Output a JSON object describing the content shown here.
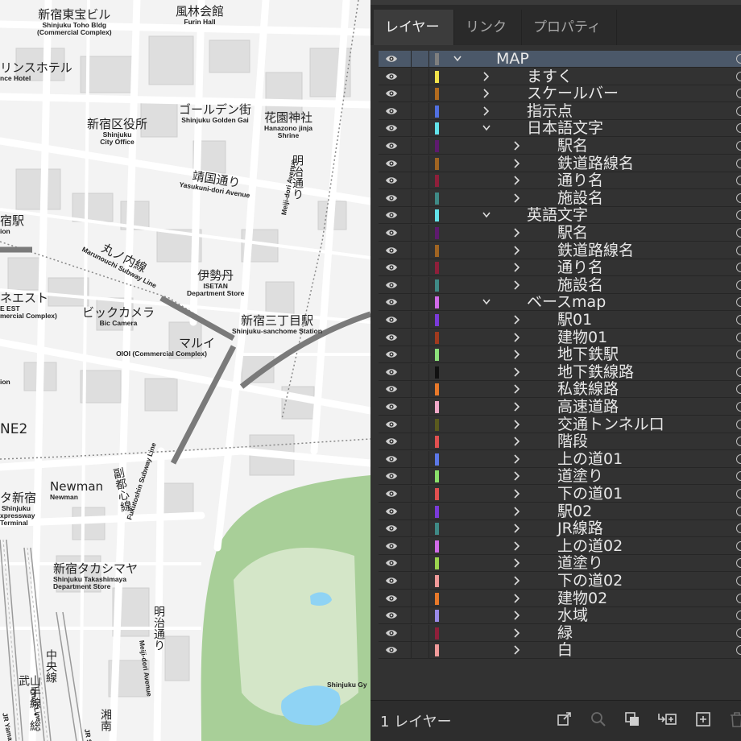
{
  "map": {
    "labels": {
      "toho_jp": "新宿東宝ビル",
      "toho_en1": "Shinjuku Toho Bldg",
      "toho_en2": "(Commercial Complex)",
      "furin_jp": "風林会館",
      "furin_en": "Furin Hall",
      "hotel_jp": "リンスホテル",
      "hotel_en": "nce Hotel",
      "golden_jp": "ゴールデン街",
      "golden_en": "Shinjuku Golden Gai",
      "hanazono_jp": "花園神社",
      "hanazono_en1": "Hanazono jinja",
      "hanazono_en2": "Shrine",
      "office_jp": "新宿区役所",
      "office_en1": "Shinjuku",
      "office_en2": "City Office",
      "yasukuni_jp": "靖国通り",
      "yasukuni_en": "Yasukuni-dori Avenue",
      "meiji1_jp": "明治通り",
      "meiji1_en": "Meiji-dori Avenue",
      "station_jp": "宿駅",
      "station_en": "ion",
      "marunouchi_jp": "丸ノ内線",
      "marunouchi_en": "Marunouchi Subway Line",
      "isetan_jp": "伊勢丹",
      "isetan_en1": "ISETAN",
      "isetan_en2": "Department Store",
      "lumine_jp": "ネエスト",
      "lumine_en1": "E EST",
      "lumine_en2": "mercial Complex)",
      "bic_jp": "ビックカメラ",
      "bic_en": "Bic Camera",
      "sanchome_jp": "新宿三丁目駅",
      "sanchome_en": "Shinjuku-sanchome Station",
      "marui_jp": "マルイ",
      "marui_en": "OIOI (Commercial Complex)",
      "ion2": "ion",
      "ne2": "NE2",
      "fukutoshin_jp": "副都心線",
      "fukutoshin_en": "Fukutoshin Subway Line",
      "newman_jp": "Newman",
      "newman_en": "Newman",
      "busta_jp": "タ新宿",
      "busta_en1": "Shinjuku",
      "busta_en2": "xpressway",
      "busta_en3": "Terminal",
      "takashimaya_jp": "新宿タカシマヤ",
      "takashimaya_en1": "Shinjuku Takashimaya",
      "takashimaya_en2": "Department Store",
      "meiji2_jp": "明治通り",
      "meiji2_en": "Meiji-dori Avenue",
      "chuo_jp": "中央線",
      "chuo_en": "Chuo Line",
      "yamanote_jp": "山手線・総武",
      "yamanote_en": "JR Yamanote Line",
      "shonan_jp": "湘南",
      "shonan_en": "JR Shon",
      "gyoen_en": "Shinjuku Gy"
    }
  },
  "panel": {
    "tabs": [
      {
        "label": "レイヤー",
        "active": true
      },
      {
        "label": "リンク",
        "active": false
      },
      {
        "label": "プロパティ",
        "active": false
      }
    ],
    "layers": [
      {
        "label": "MAP",
        "color": "#7f7f7f",
        "level": 0,
        "expanded": true,
        "selected": true
      },
      {
        "label": "ますく",
        "color": "#f0e24a",
        "level": 1,
        "expanded": false
      },
      {
        "label": "スケールバー",
        "color": "#b26b1f",
        "level": 1,
        "expanded": false
      },
      {
        "label": "指示点",
        "color": "#5170e0",
        "level": 1,
        "expanded": false
      },
      {
        "label": "日本語文字",
        "color": "#62e3ea",
        "level": 1,
        "expanded": true
      },
      {
        "label": "駅名",
        "color": "#5e1a6e",
        "level": 2,
        "expanded": false
      },
      {
        "label": "鉄道路線名",
        "color": "#a06422",
        "level": 2,
        "expanded": false
      },
      {
        "label": "通り名",
        "color": "#8e1f3a",
        "level": 2,
        "expanded": false
      },
      {
        "label": "施設名",
        "color": "#3f8a86",
        "level": 2,
        "expanded": false
      },
      {
        "label": "英語文字",
        "color": "#62e3ea",
        "level": 1,
        "expanded": true
      },
      {
        "label": "駅名",
        "color": "#5e1a6e",
        "level": 2,
        "expanded": false
      },
      {
        "label": "鉄道路線名",
        "color": "#a06422",
        "level": 2,
        "expanded": false
      },
      {
        "label": "通り名",
        "color": "#8e1f3a",
        "level": 2,
        "expanded": false
      },
      {
        "label": "施設名",
        "color": "#3f8a86",
        "level": 2,
        "expanded": false
      },
      {
        "label": "ベースmap",
        "color": "#d06ae8",
        "level": 1,
        "expanded": true
      },
      {
        "label": "駅01",
        "color": "#7a3ad8",
        "level": 2,
        "expanded": false
      },
      {
        "label": "建物01",
        "color": "#a13a1e",
        "level": 2,
        "expanded": false
      },
      {
        "label": "地下鉄駅",
        "color": "#8ce07a",
        "level": 2,
        "expanded": false
      },
      {
        "label": "地下鉄線路",
        "color": "#111111",
        "level": 2,
        "expanded": false
      },
      {
        "label": "私鉄線路",
        "color": "#e8792a",
        "level": 2,
        "expanded": false
      },
      {
        "label": "高速道路",
        "color": "#f0a8c8",
        "level": 2,
        "expanded": false
      },
      {
        "label": "交通トンネル口",
        "color": "#5a5a1e",
        "level": 2,
        "expanded": false
      },
      {
        "label": "階段",
        "color": "#e05050",
        "level": 2,
        "expanded": false
      },
      {
        "label": "上の道01",
        "color": "#5c78e8",
        "level": 2,
        "expanded": false
      },
      {
        "label": "道塗り",
        "color": "#8ae06a",
        "level": 2,
        "expanded": false
      },
      {
        "label": "下の道01",
        "color": "#e05050",
        "level": 2,
        "expanded": false
      },
      {
        "label": "駅02",
        "color": "#7a3ad8",
        "level": 2,
        "expanded": false
      },
      {
        "label": "JR線路",
        "color": "#3f8a86",
        "level": 2,
        "expanded": false
      },
      {
        "label": "上の道02",
        "color": "#d06ae8",
        "level": 2,
        "expanded": false
      },
      {
        "label": "道塗り",
        "color": "#9bd44e",
        "level": 2,
        "expanded": false
      },
      {
        "label": "下の道02",
        "color": "#f09a9a",
        "level": 2,
        "expanded": false
      },
      {
        "label": "建物02",
        "color": "#e8792a",
        "level": 2,
        "expanded": false
      },
      {
        "label": "水域",
        "color": "#9a8ae8",
        "level": 2,
        "expanded": false
      },
      {
        "label": "緑",
        "color": "#8e1f3a",
        "level": 2,
        "expanded": false
      },
      {
        "label": "白",
        "color": "#f09a9a",
        "level": 2,
        "expanded": false
      }
    ],
    "footer": {
      "layer_count": "1 レイヤー"
    }
  }
}
